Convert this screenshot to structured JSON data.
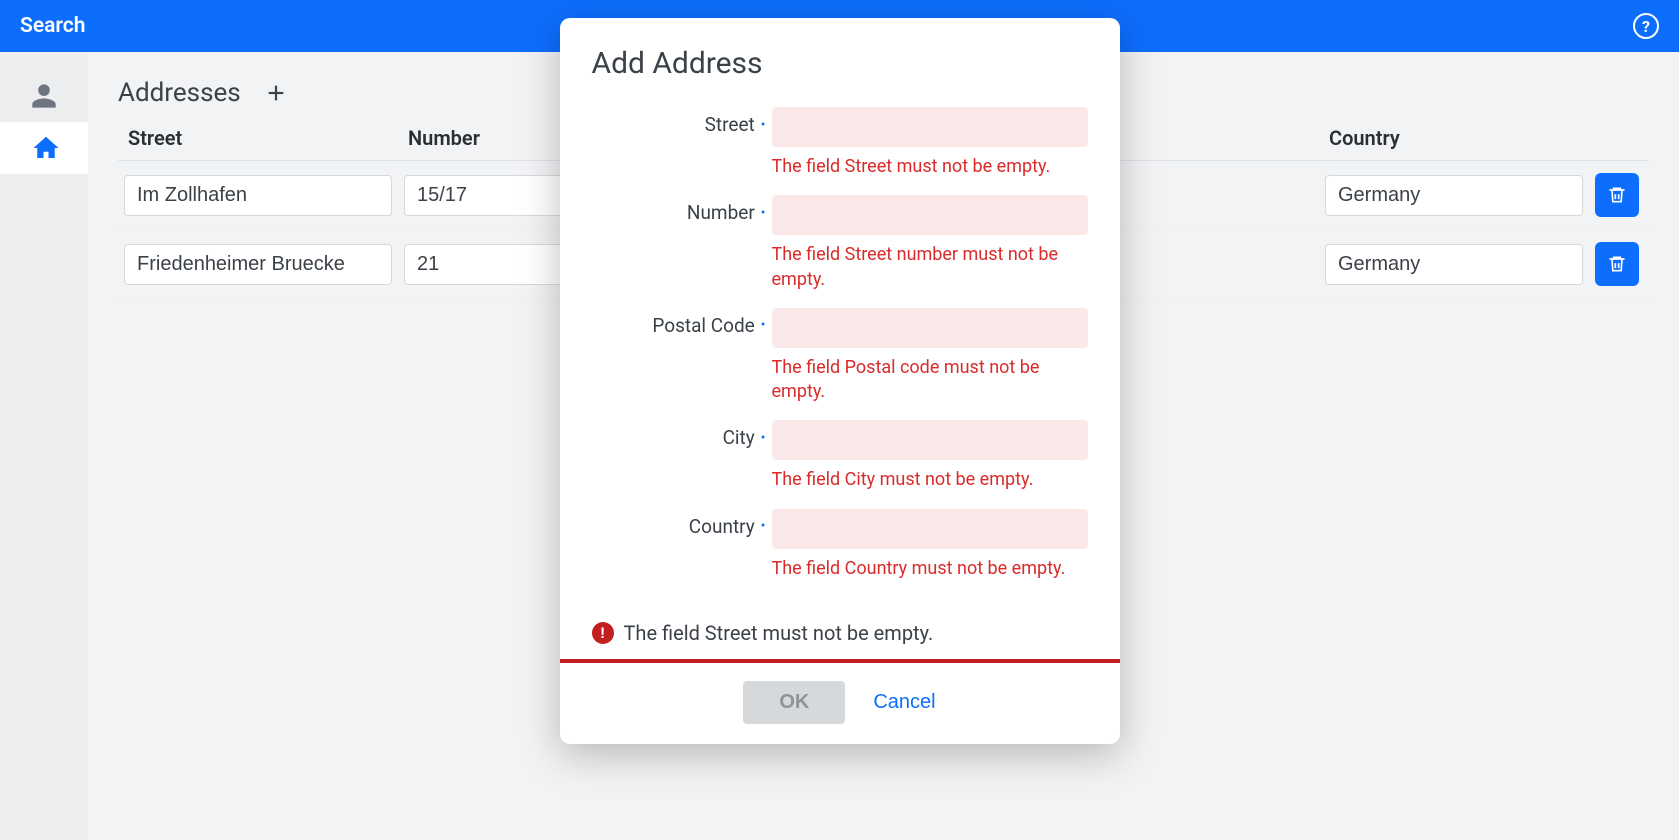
{
  "topbar": {
    "title": "Search"
  },
  "section": {
    "heading": "Addresses"
  },
  "columns": {
    "street": "Street",
    "number": "Number",
    "country": "Country"
  },
  "rows": [
    {
      "street": "Im Zollhafen",
      "number": "15/17",
      "country": "Germany"
    },
    {
      "street": "Friedenheimer Bruecke",
      "number": "21",
      "country": "Germany"
    }
  ],
  "modal": {
    "title": "Add Address",
    "fields": {
      "street": {
        "label": "Street",
        "error": "The field Street must not be empty."
      },
      "number": {
        "label": "Number",
        "error": "The field Street number must not be empty."
      },
      "postal": {
        "label": "Postal Code",
        "error": "The field Postal code must not be empty."
      },
      "city": {
        "label": "City",
        "error": "The field City must not be empty."
      },
      "country": {
        "label": "Country",
        "error": "The field Country must not be empty."
      }
    },
    "notice": "The field Street must not be empty.",
    "ok_label": "OK",
    "cancel_label": "Cancel"
  }
}
